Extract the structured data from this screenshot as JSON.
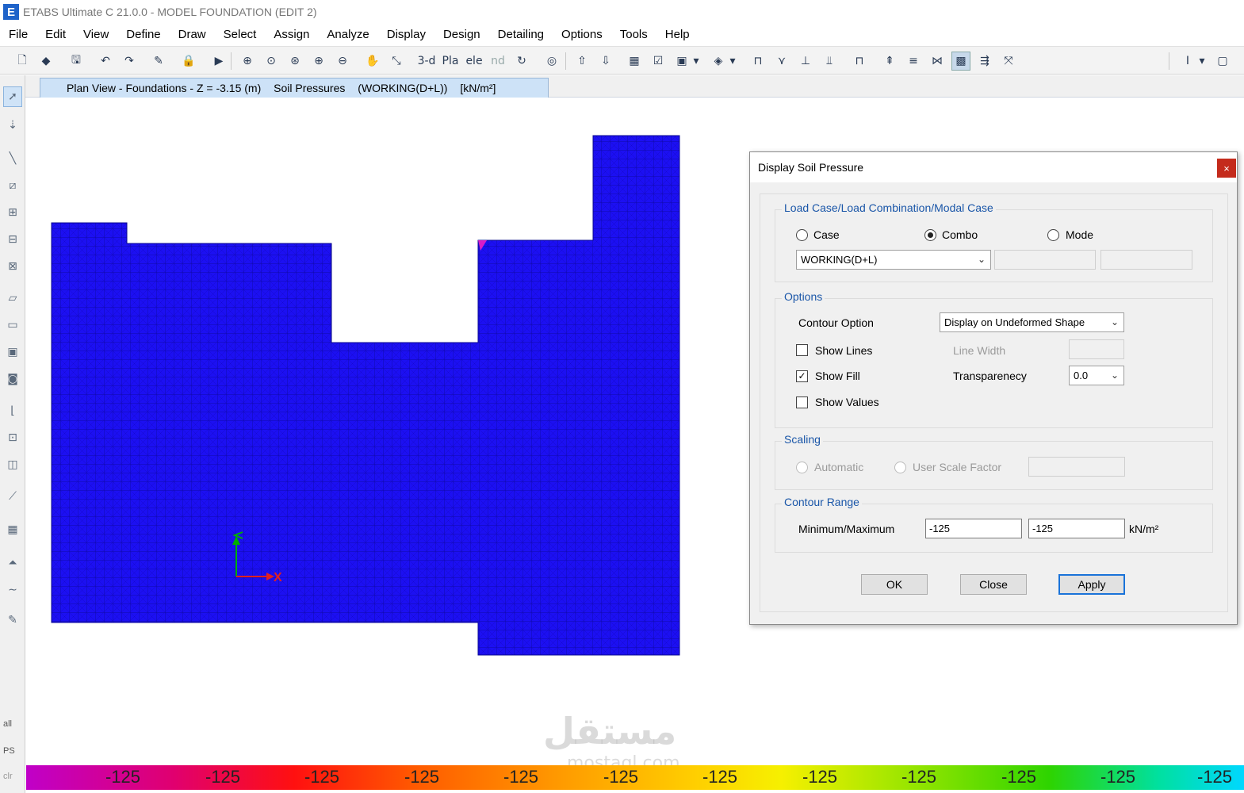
{
  "window": {
    "logo_letter": "E",
    "title": "ETABS Ultimate C 21.0.0 - MODEL FOUNDATION (EDIT 2)"
  },
  "menu": [
    "File",
    "Edit",
    "View",
    "Define",
    "Draw",
    "Select",
    "Assign",
    "Analyze",
    "Display",
    "Design",
    "Detailing",
    "Options",
    "Tools",
    "Help"
  ],
  "toolbar_text_buttons": {
    "three_d": "3-d",
    "plan": "Pla",
    "elev": "ele",
    "nd": "nd"
  },
  "view_tab": {
    "view_label": "Plan View - Foundations - Z = -3.15 (m)",
    "result_label": "Soil Pressures",
    "combo_label": "(WORKING(D+L))",
    "units": "[kN/m²]"
  },
  "model_colors": {
    "fill": "#1c10f2",
    "mesh": "#0a0890",
    "accent": "#d81cc8"
  },
  "axes": {
    "x_label": "X"
  },
  "colorbar": {
    "labels": [
      "-125",
      "-125",
      "-125",
      "-125",
      "-125",
      "-125",
      "-125",
      "-125",
      "-125",
      "-125",
      "-125",
      "-125",
      "-125"
    ]
  },
  "left_toolbar_text": {
    "all": "all",
    "ps": "PS",
    "clr": "clr"
  },
  "watermark": {
    "arabic": "مستقل",
    "latin": "mostaql.com"
  },
  "dialog": {
    "title": "Display Soil Pressure",
    "close_glyph": "×",
    "load_case_group": {
      "title": "Load Case/Load Combination/Modal Case",
      "radio_case": "Case",
      "radio_combo": "Combo",
      "radio_mode": "Mode",
      "selected_combo": "WORKING(D+L)"
    },
    "options_group": {
      "title": "Options",
      "contour_option_label": "Contour Option",
      "contour_option_value": "Display on Undeformed Shape",
      "show_lines": "Show Lines",
      "show_fill": "Show Fill",
      "show_values": "Show Values",
      "show_fill_checked": true,
      "line_width_label": "Line Width",
      "transparency_label": "Transparenecy",
      "transparency_value": "0.0"
    },
    "scaling_group": {
      "title": "Scaling",
      "automatic": "Automatic",
      "user_scale": "User Scale Factor"
    },
    "contour_range_group": {
      "title": "Contour Range",
      "minmax_label": "Minimum/Maximum",
      "min": "-125",
      "max": "-125",
      "units": "kN/m²"
    },
    "buttons": {
      "ok": "OK",
      "close": "Close",
      "apply": "Apply"
    }
  }
}
